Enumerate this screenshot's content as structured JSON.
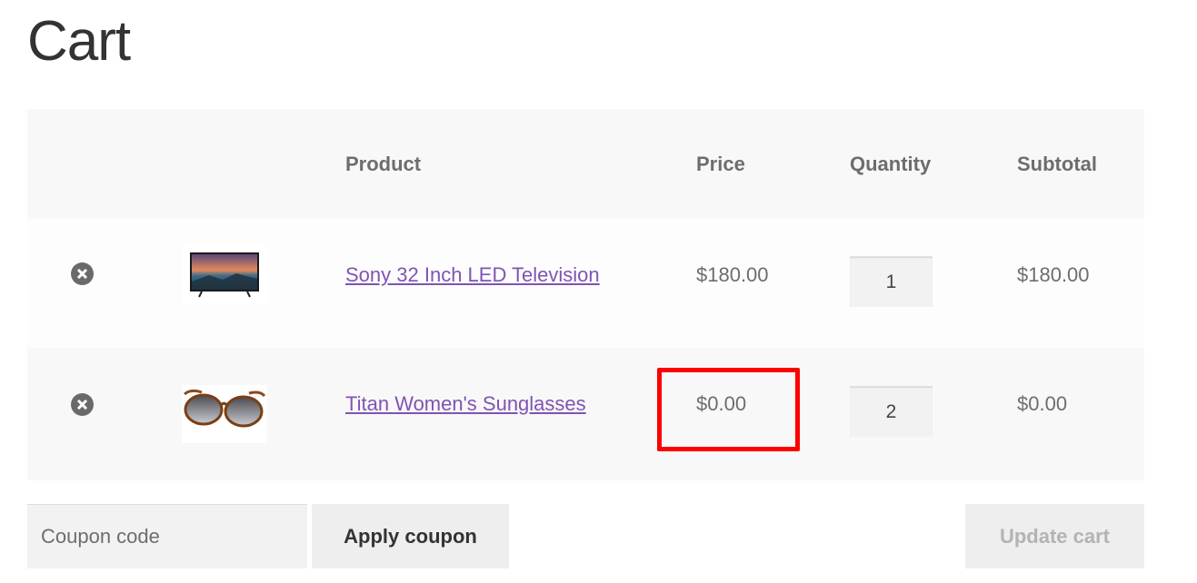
{
  "page": {
    "title": "Cart"
  },
  "table": {
    "headers": {
      "product": "Product",
      "price": "Price",
      "quantity": "Quantity",
      "subtotal": "Subtotal"
    },
    "rows": [
      {
        "product_name": "Sony 32 Inch LED Television",
        "price": "$180.00",
        "quantity": "1",
        "subtotal": "$180.00",
        "thumbnail": "tv-thumbnail"
      },
      {
        "product_name": "Titan Women's Sunglasses",
        "price": "$0.00",
        "quantity": "2",
        "subtotal": "$0.00",
        "thumbnail": "sunglasses-thumbnail"
      }
    ]
  },
  "actions": {
    "coupon_placeholder": "Coupon code",
    "apply_coupon_label": "Apply coupon",
    "update_cart_label": "Update cart"
  },
  "colors": {
    "link": "#7f54b3",
    "highlight": "#ff0000",
    "table_background": "#f8f8f8",
    "remove_icon": "#6a6a6a"
  },
  "icons": {
    "remove": "remove-item-icon"
  }
}
